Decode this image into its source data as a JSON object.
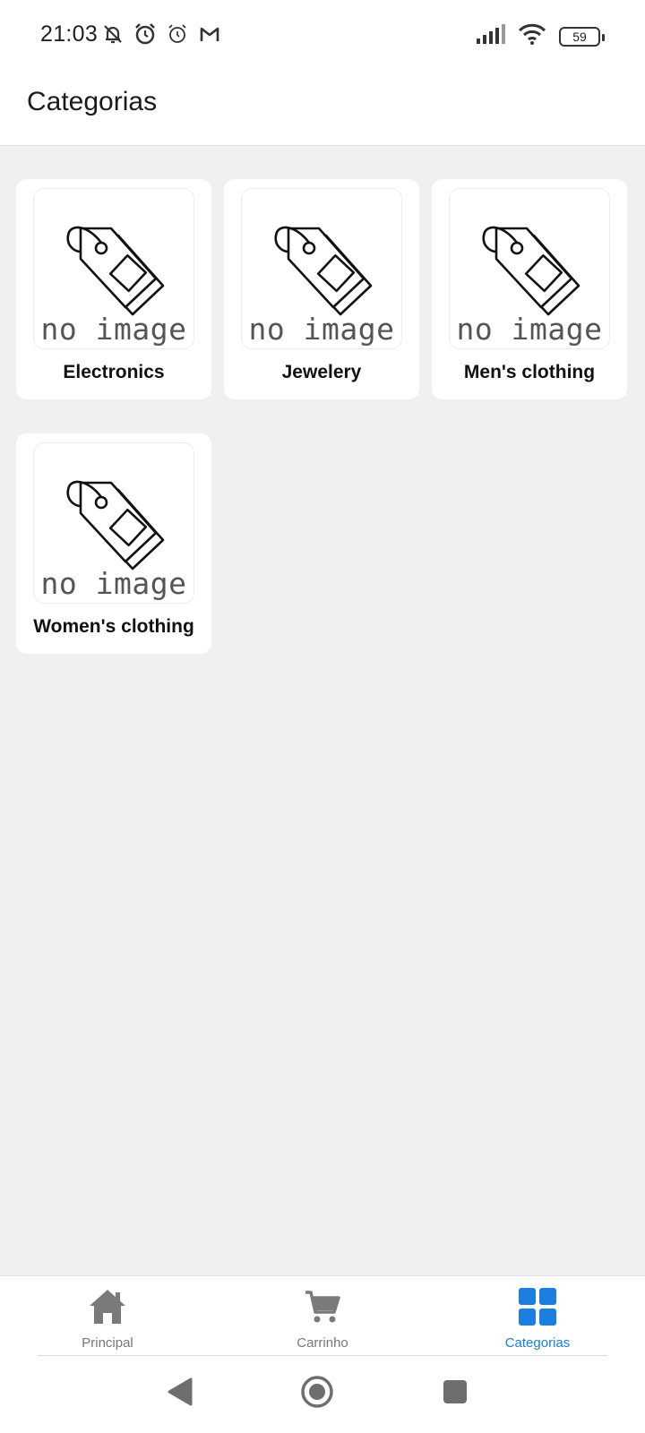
{
  "status_bar": {
    "time": "21:03",
    "battery_level": "59",
    "icons": [
      "bell-off-icon",
      "alarm-icon",
      "alarm-outline-icon",
      "gmail-icon",
      "signal-icon",
      "wifi-icon",
      "battery-icon"
    ]
  },
  "header": {
    "title": "Categorias"
  },
  "categories": [
    {
      "label": "Electronics",
      "image_text": "no image"
    },
    {
      "label": "Jewelery",
      "image_text": "no image"
    },
    {
      "label": "Men's clothing",
      "image_text": "no image"
    },
    {
      "label": "Women's clothing",
      "image_text": "no image"
    }
  ],
  "bottom_nav": {
    "items": [
      {
        "label": "Principal",
        "icon": "home-icon",
        "active": false
      },
      {
        "label": "Carrinho",
        "icon": "cart-icon",
        "active": false
      },
      {
        "label": "Categorias",
        "icon": "grid-icon",
        "active": true
      }
    ]
  },
  "colors": {
    "accent": "#1a7fe0",
    "background": "#f0f0f0",
    "card": "#ffffff",
    "inactive_icon": "#7a7a7a"
  }
}
